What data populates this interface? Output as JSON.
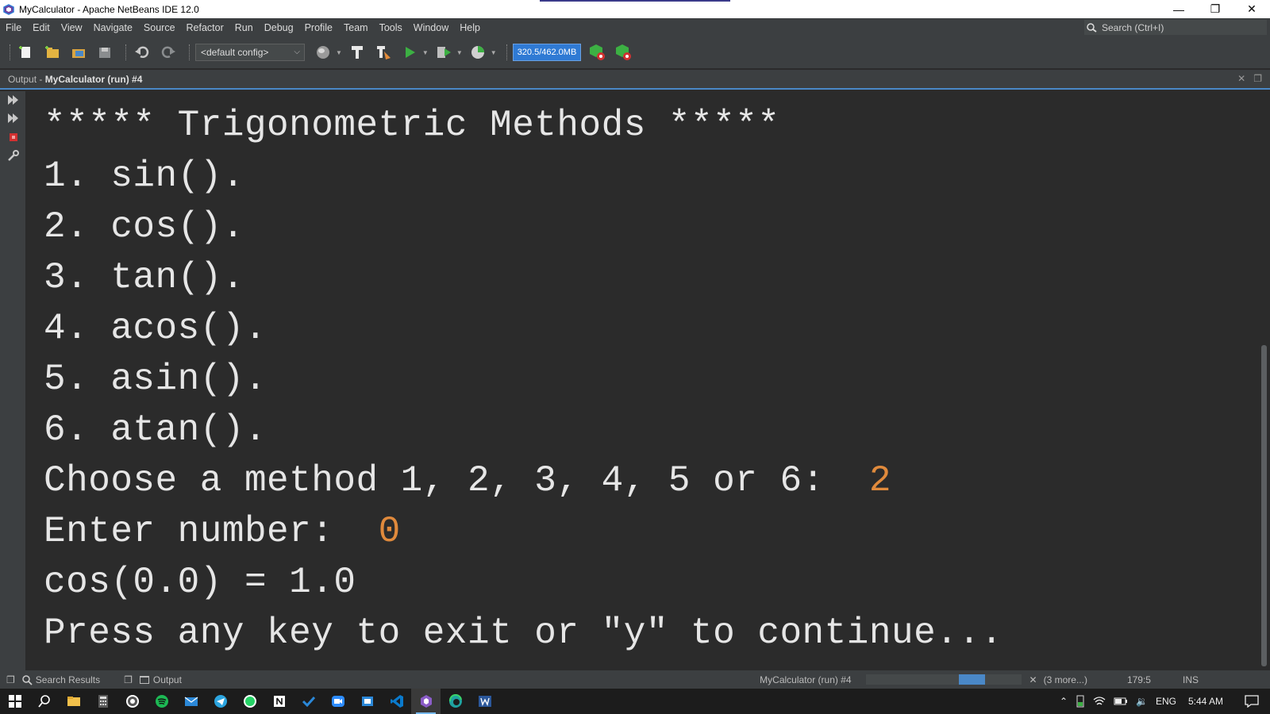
{
  "window": {
    "title": "MyCalculator - Apache NetBeans IDE 12.0",
    "controls": [
      "minimize-icon",
      "restore-icon",
      "close-icon"
    ]
  },
  "menu": {
    "items": [
      "File",
      "Edit",
      "View",
      "Navigate",
      "Source",
      "Refactor",
      "Run",
      "Debug",
      "Profile",
      "Team",
      "Tools",
      "Window",
      "Help"
    ]
  },
  "search": {
    "placeholder": "Search (Ctrl+I)"
  },
  "toolbar": {
    "config": "<default config>",
    "memory": "320.5/462.0MB"
  },
  "output": {
    "tab_prefix": "Output - ",
    "tab_title": "MyCalculator (run) #4",
    "lines": [
      {
        "text": "***** Trigonometric Methods *****"
      },
      {
        "text": "1. sin()."
      },
      {
        "text": "2. cos()."
      },
      {
        "text": "3. tan()."
      },
      {
        "text": "4. acos()."
      },
      {
        "text": "5. asin()."
      },
      {
        "text": "6. atan()."
      },
      {
        "text": "Choose a method 1, 2, 3, 4, 5 or 6:  ",
        "input": "2"
      },
      {
        "text": "Enter number:  ",
        "input": "0"
      },
      {
        "text": "cos(0.0) = 1.0"
      },
      {
        "text": "Press any key to exit or \"y\" to continue..."
      }
    ]
  },
  "status": {
    "search_results": "Search Results",
    "output": "Output",
    "run_label": "MyCalculator (run) #4",
    "progress_fraction": 0.72,
    "more": "(3 more...)",
    "position": "179:5",
    "mode": "INS"
  },
  "taskbar": {
    "tray": {
      "lang": "ENG",
      "time": "5:44 AM"
    }
  },
  "colors": {
    "accent": "#4a88c7",
    "user_input": "#e08a3c",
    "memory_bg": "#2f7ad4"
  }
}
